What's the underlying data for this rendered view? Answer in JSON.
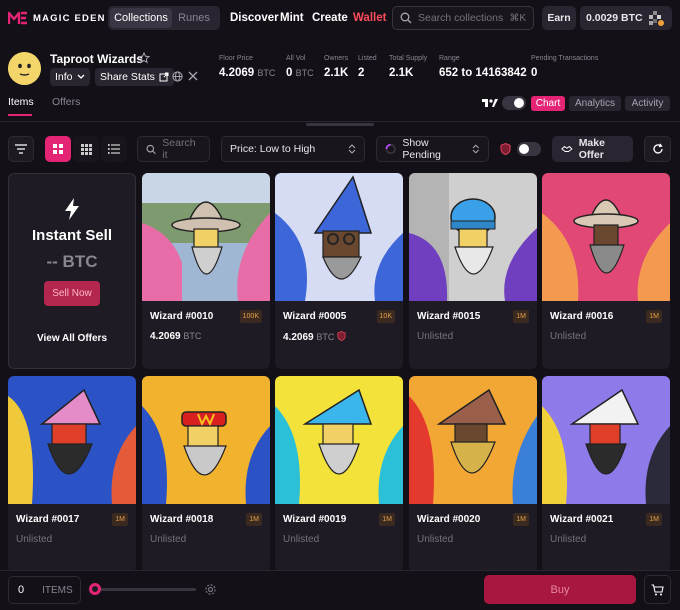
{
  "brand": {
    "name": "MAGIC EDEN"
  },
  "nav": {
    "toggle": [
      "Collections",
      "Runes"
    ],
    "links": [
      "Discover",
      "Mint",
      "Create",
      "Wallet"
    ],
    "search_placeholder": "Search collections",
    "search_shortcut": "⌘K",
    "earn": "Earn",
    "balance": "0.0029 BTC"
  },
  "collection": {
    "name": "Taproot Wizards",
    "info_label": "Info",
    "share_label": "Share Stats",
    "stats": [
      {
        "label": "Floor Price",
        "value": "4.2069",
        "unit": "BTC"
      },
      {
        "label": "All Vol",
        "value": "0",
        "unit": "BTC"
      },
      {
        "label": "Owners",
        "value": "2.1K",
        "unit": ""
      },
      {
        "label": "Listed",
        "value": "2",
        "unit": ""
      },
      {
        "label": "Total Supply",
        "value": "2.1K",
        "unit": ""
      },
      {
        "label": "Range",
        "value": "652 to 14163842",
        "unit": ""
      },
      {
        "label": "Pending Transactions",
        "value": "0",
        "unit": ""
      }
    ]
  },
  "tabs": {
    "items": "Items",
    "offers": "Offers"
  },
  "view_tabs": [
    "Chart",
    "Analytics",
    "Activity"
  ],
  "toolbar": {
    "search_placeholder": "Search it",
    "sort_value": "Price: Low to High",
    "pending_label": "Show Pending",
    "make_offer": "Make Offer"
  },
  "instant_sell": {
    "title": "Instant Sell",
    "price": "-- BTC",
    "button": "Sell Now",
    "view_all": "View All Offers"
  },
  "cards": [
    {
      "name": "Wizard #0010",
      "rank": "100K",
      "price": "4.2069",
      "unit": "BTC",
      "status": ""
    },
    {
      "name": "Wizard #0005",
      "rank": "10K",
      "price": "4.2069",
      "unit": "BTC",
      "status": ""
    },
    {
      "name": "Wizard #0015",
      "rank": "1M",
      "price": "",
      "unit": "",
      "status": "Unlisted"
    },
    {
      "name": "Wizard #0016",
      "rank": "1M",
      "price": "",
      "unit": "",
      "status": "Unlisted"
    },
    {
      "name": "Wizard #0017",
      "rank": "1M",
      "price": "",
      "unit": "",
      "status": "Unlisted"
    },
    {
      "name": "Wizard #0018",
      "rank": "1M",
      "price": "",
      "unit": "",
      "status": "Unlisted"
    },
    {
      "name": "Wizard #0019",
      "rank": "1M",
      "price": "",
      "unit": "",
      "status": "Unlisted"
    },
    {
      "name": "Wizard #0020",
      "rank": "1M",
      "price": "",
      "unit": "",
      "status": "Unlisted"
    },
    {
      "name": "Wizard #0021",
      "rank": "1M",
      "price": "",
      "unit": "",
      "status": "Unlisted"
    }
  ],
  "bottom": {
    "count": "0",
    "items_label": "ITEMS",
    "buy": "Buy"
  },
  "colors": {
    "accent": "#e42575",
    "wallet": "#ff4c5b",
    "bg": "#141018",
    "card": "#1f1b24"
  }
}
